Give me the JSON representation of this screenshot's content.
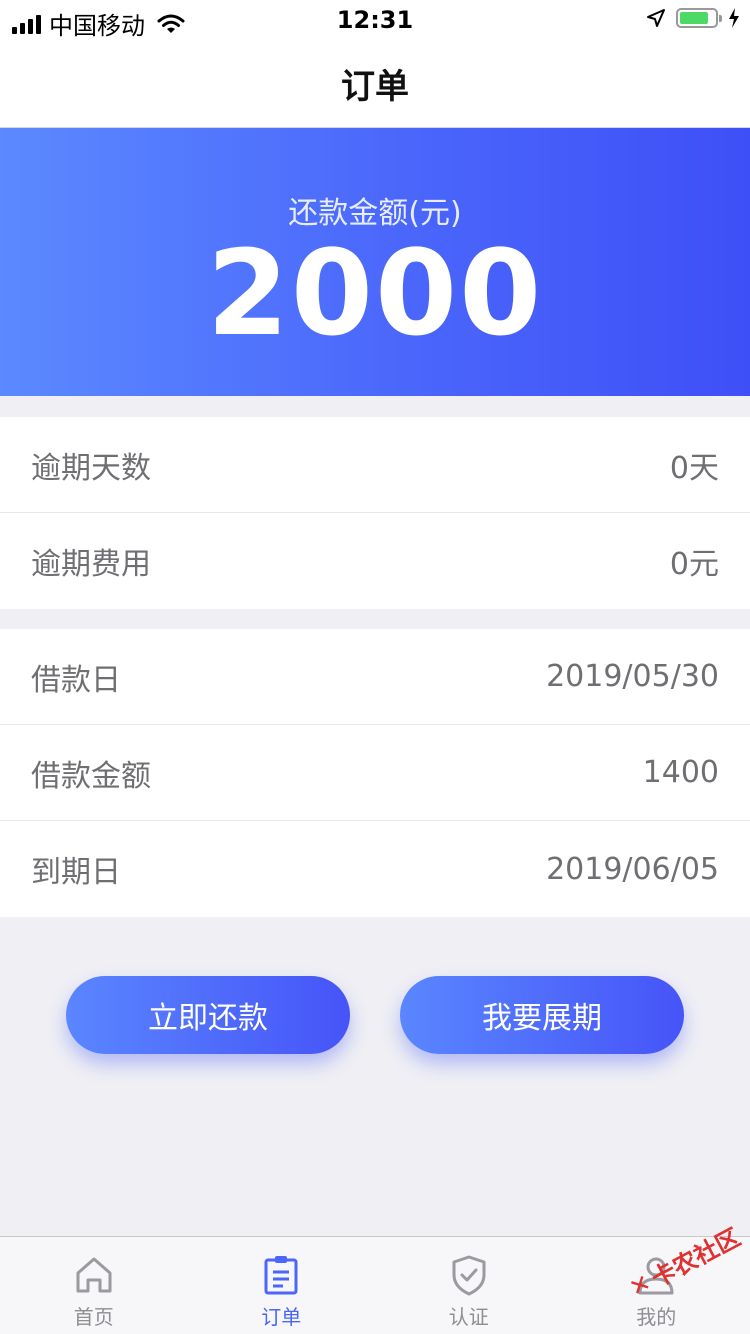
{
  "status_bar": {
    "carrier": "中国移动",
    "time": "12:31"
  },
  "nav": {
    "title": "订单"
  },
  "hero": {
    "label": "还款金额(元)",
    "amount": "2000"
  },
  "overdue": [
    {
      "label": "逾期天数",
      "value": "0天"
    },
    {
      "label": "逾期费用",
      "value": "0元"
    }
  ],
  "loan": [
    {
      "label": "借款日",
      "value": "2019/05/30"
    },
    {
      "label": "借款金额",
      "value": "1400"
    },
    {
      "label": "到期日",
      "value": "2019/06/05"
    }
  ],
  "actions": {
    "repay_label": "立即还款",
    "extend_label": "我要展期"
  },
  "tabs": [
    {
      "label": "首页",
      "icon": "home-icon",
      "active": false
    },
    {
      "label": "订单",
      "icon": "order-icon",
      "active": true
    },
    {
      "label": "认证",
      "icon": "shield-check-icon",
      "active": false
    },
    {
      "label": "我的",
      "icon": "user-icon",
      "active": false
    }
  ],
  "watermark": {
    "text": "卡农社区"
  },
  "colors": {
    "accent": "#4a66fb",
    "accent_light": "#5b89ff",
    "inactive": "#8e8e93",
    "background": "#efeff4"
  }
}
